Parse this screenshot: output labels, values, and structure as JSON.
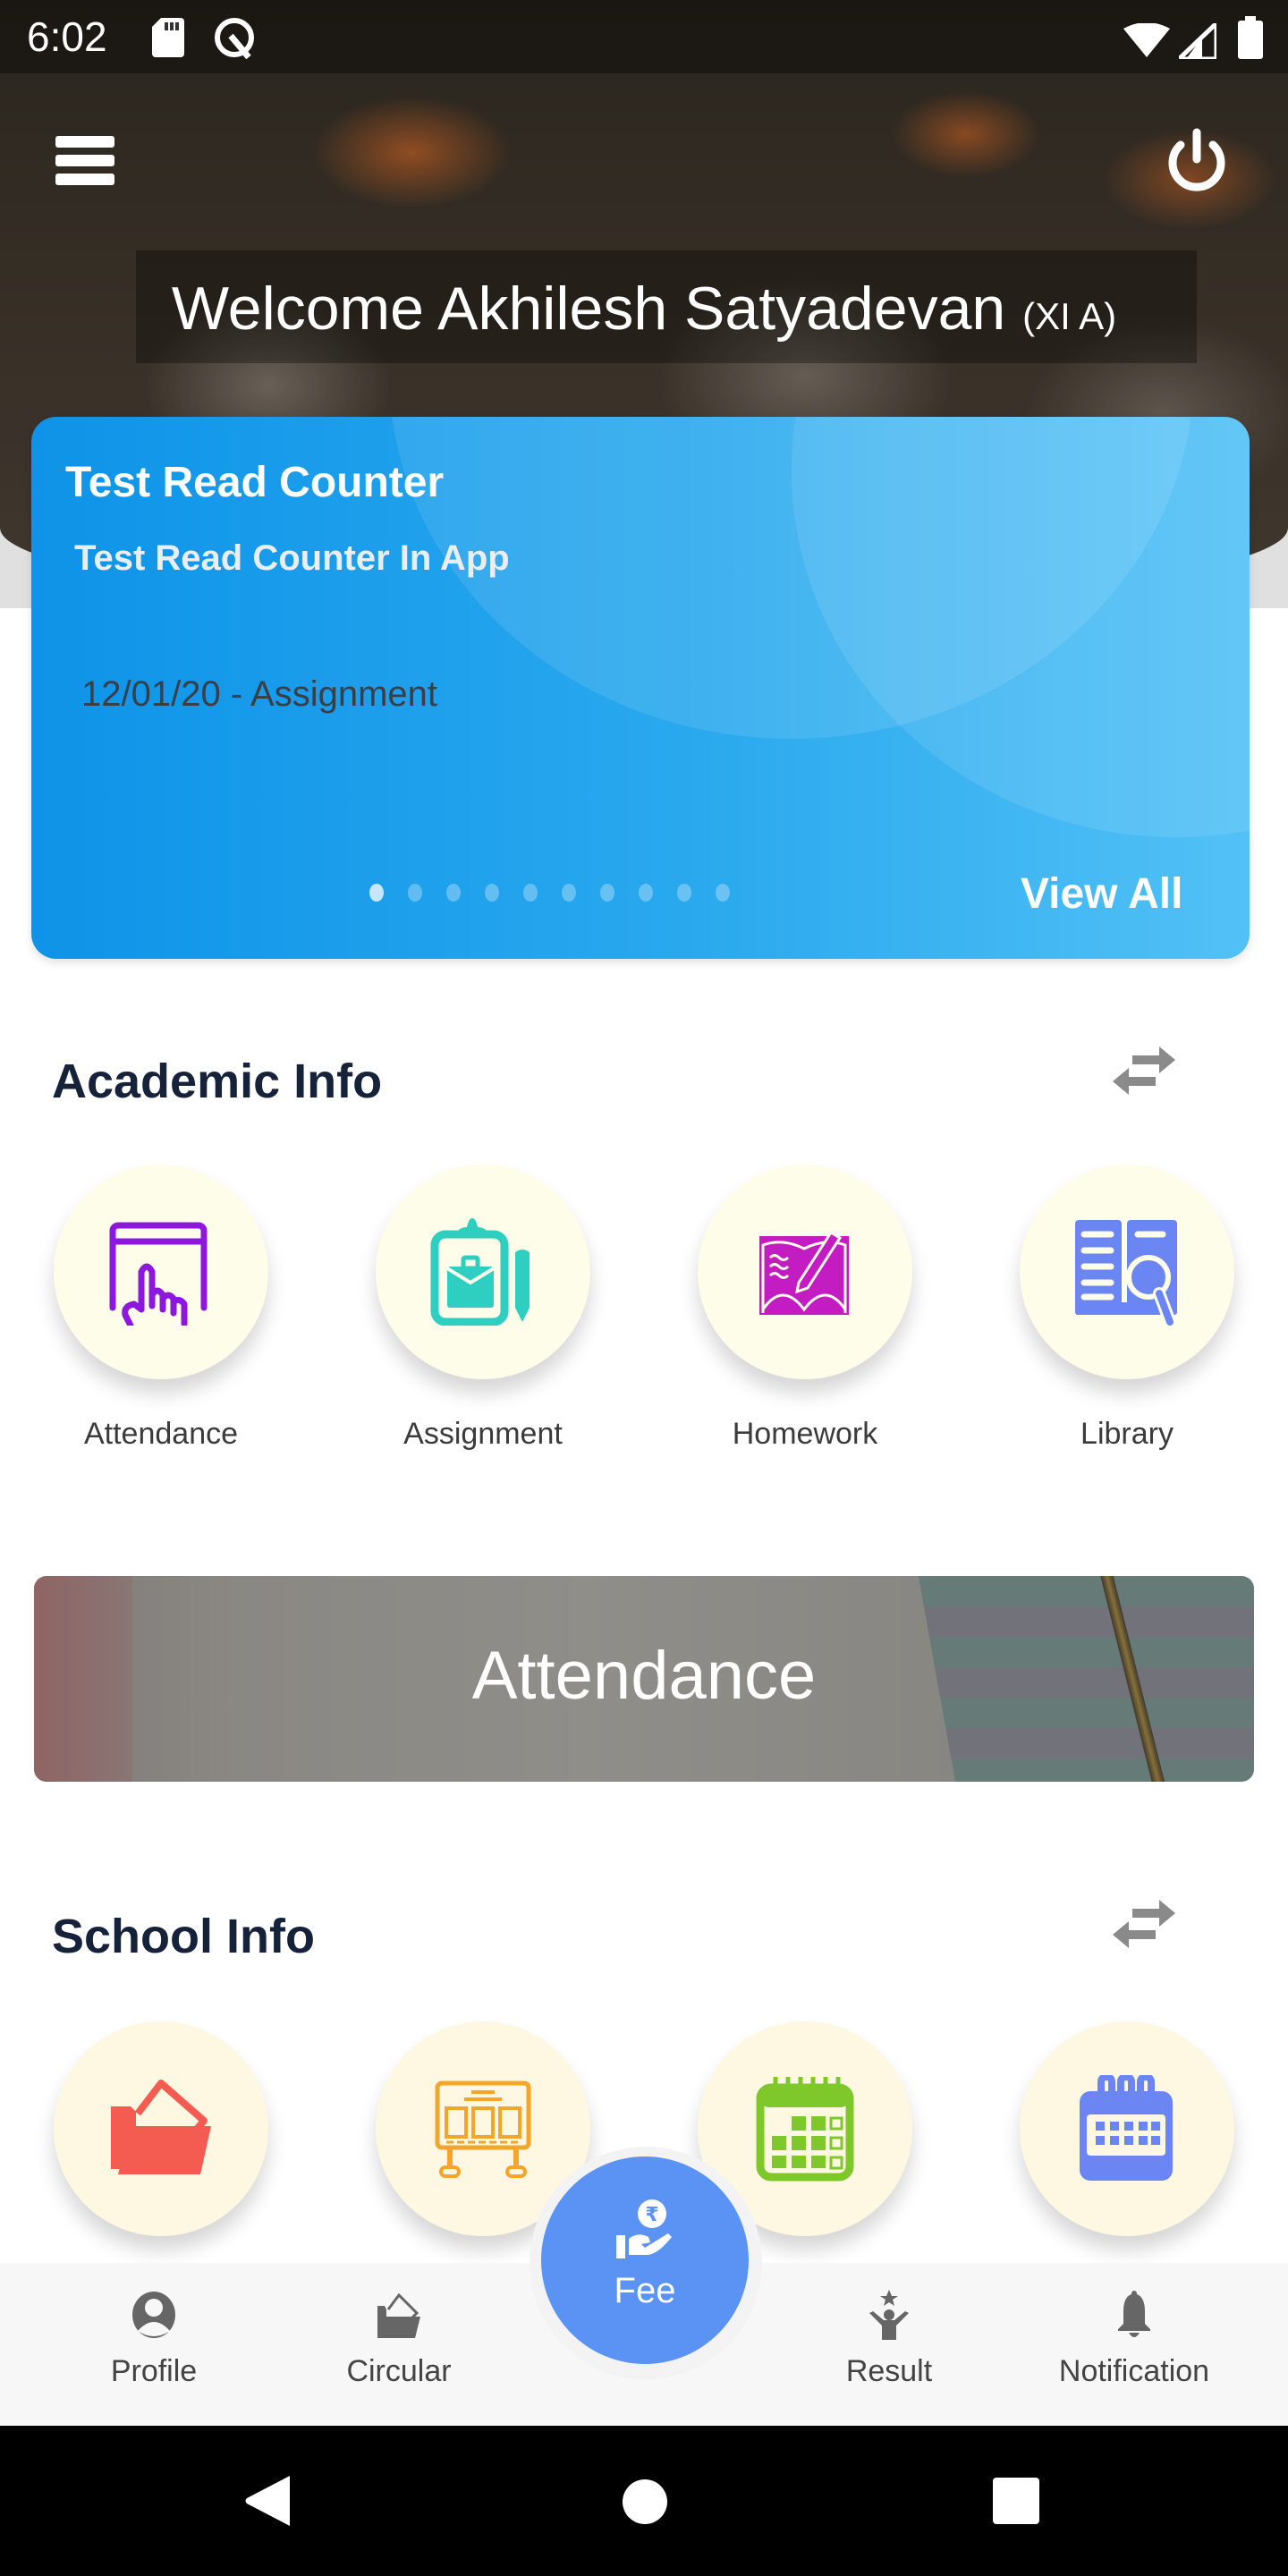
{
  "status_bar": {
    "time": "6:02",
    "left_icons": [
      "sd-card-icon",
      "q-icon"
    ],
    "right_icons": [
      "wifi-icon",
      "signal-icon",
      "battery-icon"
    ]
  },
  "header": {
    "menu_icon": "hamburger-menu-icon",
    "power_icon": "power-icon",
    "welcome_text": "Welcome Akhilesh Satyadevan",
    "class_text": "(XI A)"
  },
  "announcement": {
    "title": "Test Read Counter",
    "subtitle": "Test Read Counter In App",
    "meta": "12/01/20 - Assignment",
    "view_all_label": "View All",
    "page_count": 10,
    "active_page": 1,
    "colors": {
      "start": "#0e93e8",
      "end": "#52c1f6"
    }
  },
  "academic_info": {
    "title": "Academic Info",
    "swap_icon": "swap-arrows-icon",
    "items": [
      {
        "label": "Attendance",
        "icon": "attendance-touch-icon",
        "color": "#8e17e0"
      },
      {
        "label": "Assignment",
        "icon": "clipboard-icon",
        "color": "#2ecfc0"
      },
      {
        "label": "Homework",
        "icon": "book-pencil-icon",
        "color": "#c21cc2"
      },
      {
        "label": "Library",
        "icon": "book-search-icon",
        "color": "#6b86f2"
      }
    ]
  },
  "attendance_banner": {
    "label": "Attendance"
  },
  "school_info": {
    "title": "School Info",
    "swap_icon": "swap-arrows-icon",
    "items": [
      {
        "icon": "folder-icon",
        "color": "#f45b51"
      },
      {
        "icon": "notice-board-icon",
        "color": "#f4a52a"
      },
      {
        "icon": "calendar-grid-icon",
        "color": "#7ec82c"
      },
      {
        "icon": "calendar-icon",
        "color": "#6b86f2"
      }
    ]
  },
  "bottom_nav": {
    "items": [
      {
        "label": "Profile",
        "icon": "profile-icon"
      },
      {
        "label": "Circular",
        "icon": "circular-folder-icon"
      },
      {
        "label": "Result",
        "icon": "result-trophy-person-icon"
      },
      {
        "label": "Notification",
        "icon": "bell-icon"
      }
    ],
    "fee": {
      "label": "Fee",
      "icon": "rupee-hand-icon",
      "color": "#5a93f4"
    }
  },
  "system_nav": {
    "back": "back-icon",
    "home": "home-icon",
    "recents": "recents-icon"
  }
}
